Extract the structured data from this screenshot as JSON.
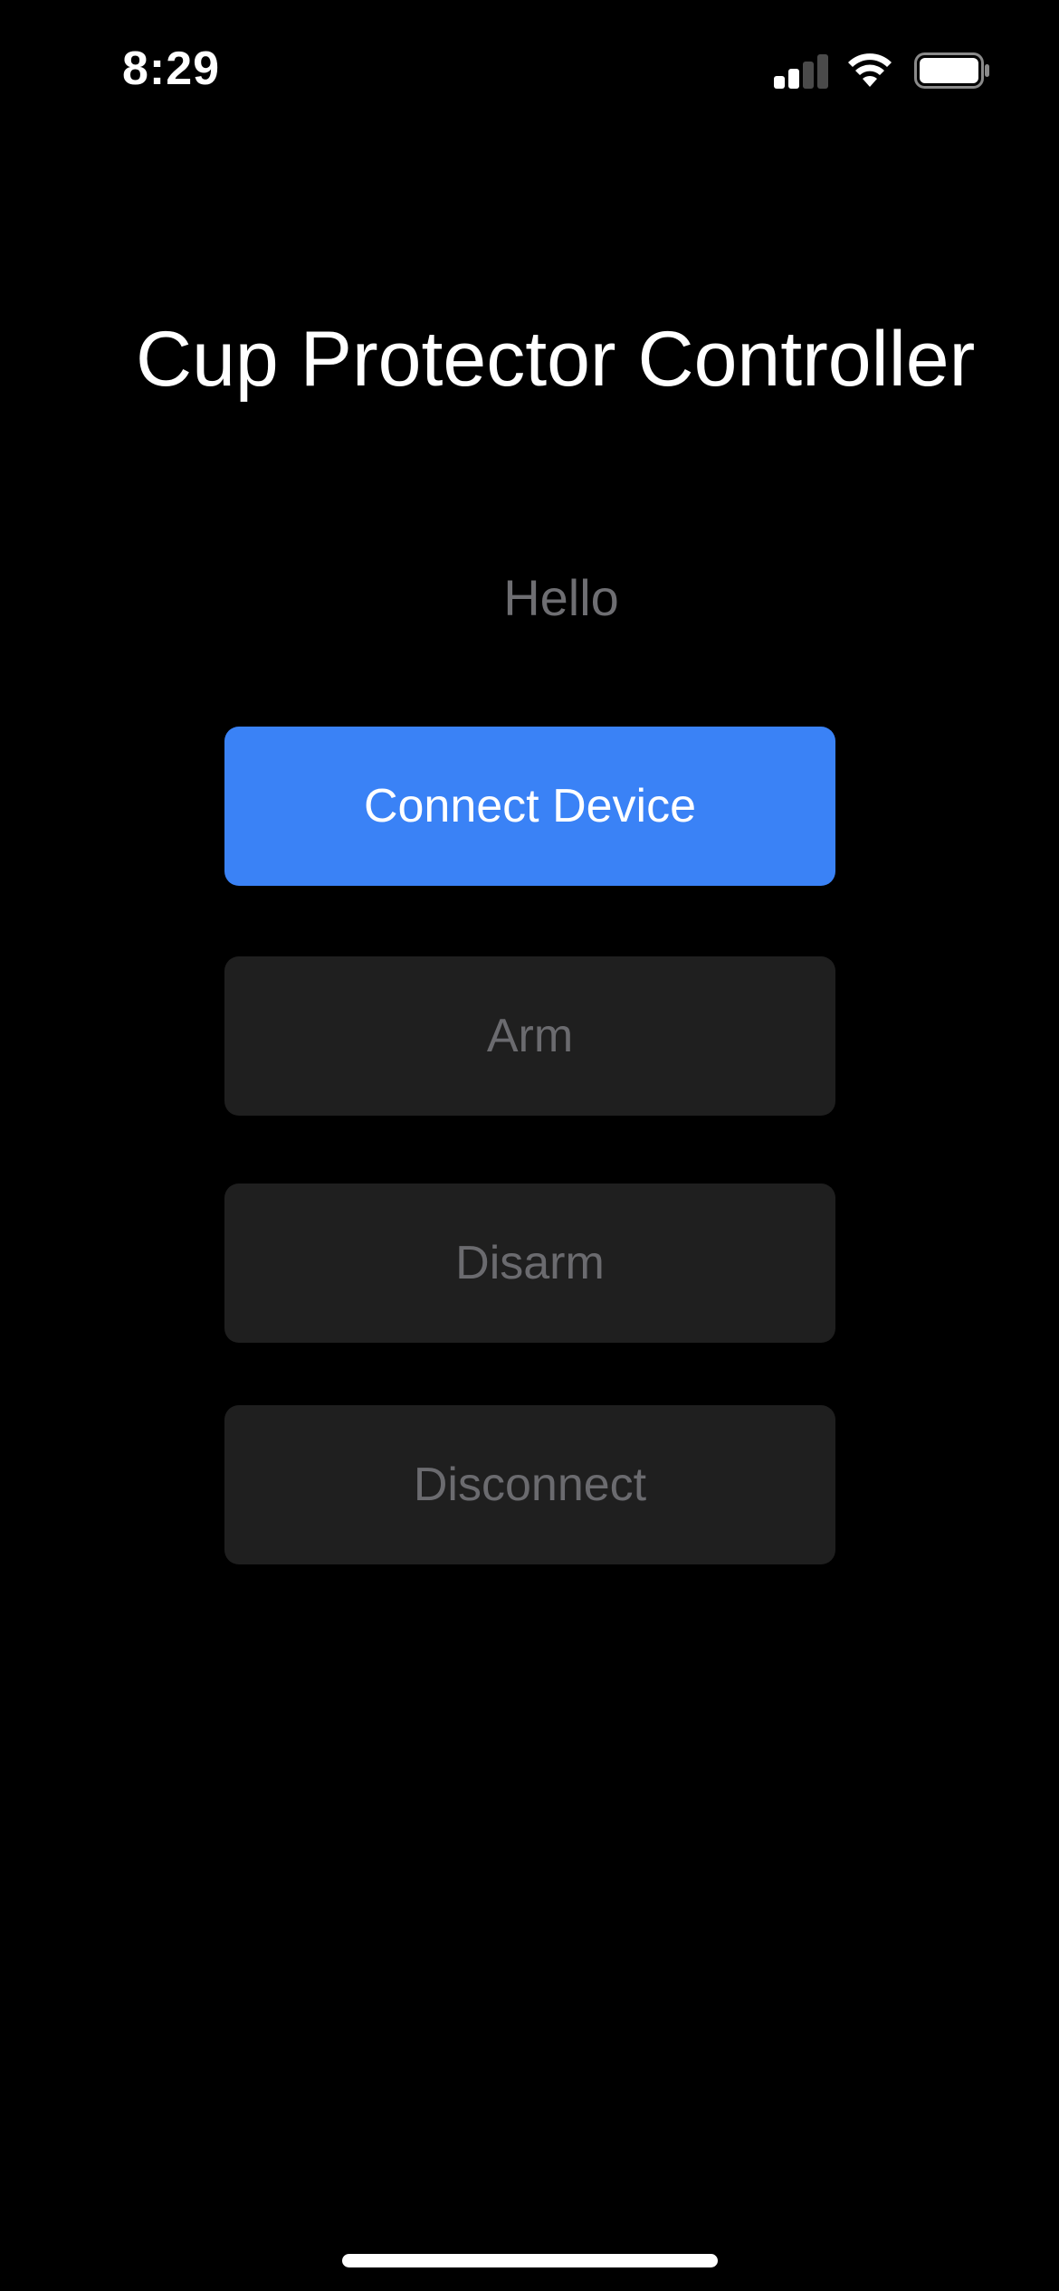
{
  "status_bar": {
    "time": "8:29",
    "signal_icon": "cellular-signal-icon",
    "signal_strength": 2,
    "signal_total": 4,
    "wifi_icon": "wifi-icon",
    "battery_icon": "battery-icon",
    "battery_level": 1.0
  },
  "header": {
    "title": "Cup Protector Controller"
  },
  "main": {
    "status_text": "Hello",
    "buttons": {
      "connect": "Connect Device",
      "arm": "Arm",
      "disarm": "Disarm",
      "disconnect": "Disconnect"
    }
  },
  "colors": {
    "background": "#000000",
    "primary_button": "#3a82f6",
    "disabled_button": "#1f1f1f",
    "disabled_text": "#6b6b6f",
    "status_text": "#6e6e72"
  }
}
